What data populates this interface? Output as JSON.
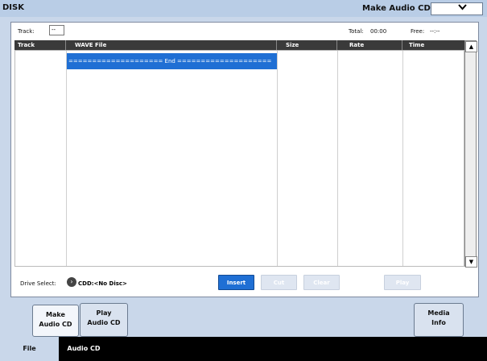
{
  "titlebar": {
    "left": "DISK",
    "right": "Make Audio CD",
    "dropdown_icon": "chevron-down-icon"
  },
  "info": {
    "track_label": "Track:",
    "track_value": "--",
    "total_label": "Total:",
    "total_value": "00:00",
    "free_label": "Free:",
    "free_value": "--:--"
  },
  "columns": [
    "Track",
    "WAVE File",
    "Size",
    "Rate",
    "Time"
  ],
  "list": {
    "end_row": "==================== End ===================="
  },
  "scroll": {
    "up": "▲",
    "down": "▼"
  },
  "drive": {
    "label": "Drive Select:",
    "value": "CDD:<No Disc>"
  },
  "buttons": {
    "insert": "Insert",
    "cut": "Cut",
    "clear": "Clear",
    "play": "Play"
  },
  "tabs": [
    {
      "line1": "Make",
      "line2": "Audio CD"
    },
    {
      "line1": "Play",
      "line2": "Audio CD"
    },
    {
      "line1": "Media",
      "line2": "Info"
    }
  ],
  "bottom_tabs": [
    "File",
    "Audio CD"
  ],
  "colors": {
    "accent": "#1f6fd4",
    "title_bg": "#b9cde6",
    "page_bg": "#c9d7ea"
  }
}
